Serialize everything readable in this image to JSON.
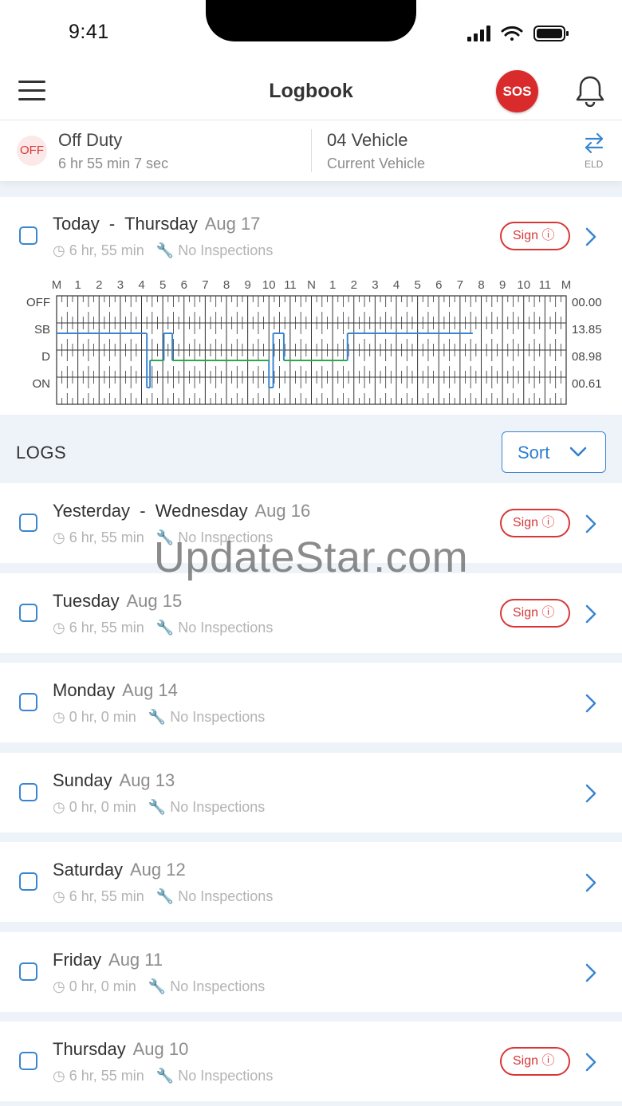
{
  "status_bar": {
    "time": "9:41"
  },
  "header": {
    "title": "Logbook",
    "sos_label": "SOS"
  },
  "duty": {
    "status_badge": "OFF",
    "status": "Off Duty",
    "duration": "6 hr 55 min 7 sec",
    "vehicle": "04 Vehicle",
    "vehicle_sub": "Current Vehicle",
    "eld_label": "ELD"
  },
  "today": {
    "day": "Today  -  Thursday",
    "date": "Aug 17",
    "hours": "6 hr, 55 min",
    "inspections": "No Inspections",
    "sign_label": "Sign"
  },
  "chart_data": {
    "type": "line",
    "hour_labels": [
      "M",
      "1",
      "2",
      "3",
      "4",
      "5",
      "6",
      "7",
      "8",
      "9",
      "10",
      "11",
      "N",
      "1",
      "2",
      "3",
      "4",
      "5",
      "6",
      "7",
      "8",
      "9",
      "10",
      "11",
      "M"
    ],
    "status_rows": [
      "OFF",
      "SB",
      "D",
      "ON"
    ],
    "totals": [
      "00.00",
      "13.85",
      "08.98",
      "00.61"
    ],
    "colors": {
      "SB": "#3a85d0",
      "D": "#2aa84a",
      "grid": "#333333"
    },
    "segments": [
      {
        "status": "SB",
        "start": 0,
        "end": 4.25
      },
      {
        "status": "ON",
        "start": 4.25,
        "end": 4.4
      },
      {
        "status": "D",
        "start": 4.4,
        "end": 5.05
      },
      {
        "status": "SB",
        "start": 5.05,
        "end": 5.45
      },
      {
        "status": "D",
        "start": 5.45,
        "end": 10.0
      },
      {
        "status": "ON",
        "start": 10.0,
        "end": 10.2
      },
      {
        "status": "SB",
        "start": 10.2,
        "end": 10.7
      },
      {
        "status": "D",
        "start": 10.7,
        "end": 13.7
      },
      {
        "status": "SB",
        "start": 13.7,
        "end": 19.6
      }
    ]
  },
  "logs": {
    "title": "LOGS",
    "sort_label": "Sort",
    "items": [
      {
        "day": "Yesterday  -  Wednesday",
        "date": "Aug 16",
        "hours": "6 hr, 55 min",
        "inspections": "No Inspections",
        "sign": "Sign"
      },
      {
        "day": "Tuesday",
        "date": "Aug 15",
        "hours": "6 hr, 55 min",
        "inspections": "No Inspections",
        "sign": "Sign"
      },
      {
        "day": "Monday",
        "date": "Aug 14",
        "hours": "0 hr, 0 min",
        "inspections": "No Inspections",
        "sign": ""
      },
      {
        "day": "Sunday",
        "date": "Aug 13",
        "hours": "0 hr, 0 min",
        "inspections": "No Inspections",
        "sign": ""
      },
      {
        "day": "Saturday",
        "date": "Aug 12",
        "hours": "6 hr, 55 min",
        "inspections": "No Inspections",
        "sign": ""
      },
      {
        "day": "Friday",
        "date": "Aug 11",
        "hours": "0 hr, 0 min",
        "inspections": "No Inspections",
        "sign": ""
      },
      {
        "day": "Thursday",
        "date": "Aug 10",
        "hours": "6 hr, 55 min",
        "inspections": "No Inspections",
        "sign": "Sign"
      }
    ]
  },
  "watermark": "UpdateStar.com"
}
